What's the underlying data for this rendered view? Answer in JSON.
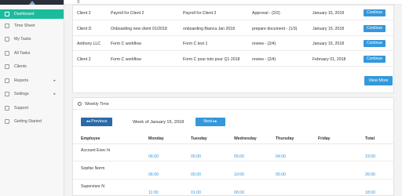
{
  "sidebar": {
    "items": [
      {
        "label": "Dashboard",
        "icon": "dashboard-icon"
      },
      {
        "label": "Time Sheet",
        "icon": "timesheet-icon"
      },
      {
        "label": "My Tasks",
        "icon": "tasks-icon"
      },
      {
        "label": "All Tasks",
        "icon": "all-tasks-icon"
      },
      {
        "label": "Clients",
        "icon": "clients-icon"
      },
      {
        "label": "Reports",
        "icon": "reports-icon",
        "caret": "▸"
      },
      {
        "label": "Settings",
        "icon": "gear-icon",
        "caret": "▸"
      },
      {
        "label": "Support",
        "icon": "support-icon"
      },
      {
        "label": "Getting Started",
        "icon": "rocket-icon"
      }
    ]
  },
  "tasks": {
    "rows": [
      {
        "client": "Client 2",
        "workflow": "Payroll for Client 2",
        "task": "Payroll for Client 2",
        "status": "Approval - (2/2)",
        "date": "January 15, 2018",
        "action": "Continue"
      },
      {
        "client": "Client D",
        "workflow": "Onboarding new client 01/2018",
        "task": "onboarding Bianca Jan 2018",
        "status": "prepare document - (1/3)",
        "date": "January 15, 2018",
        "action": "Continue"
      },
      {
        "client": "Anthony LLC",
        "workflow": "Form C workflow",
        "task": "Form C test 1",
        "status": "review - (2/4)",
        "date": "January 15, 2018",
        "action": "Continue"
      },
      {
        "client": "Client 2",
        "workflow": "Form C workflow",
        "task": "Form C pour toto pour Q1 2018",
        "status": "review - (2/4)",
        "date": "February 01, 2018",
        "action": "Continue"
      }
    ],
    "view_more": "View More"
  },
  "weekly": {
    "title": "Weekly Time",
    "prev_label": "◂◂ Previous",
    "next_label": "Next ▸▸",
    "week_label": "Week of January 15, 2018",
    "headers": [
      "Employee",
      "Monday",
      "Tuesday",
      "Wednesday",
      "Thursday",
      "Friday",
      "Total"
    ],
    "rows": [
      {
        "employee": "Account Exec hi",
        "values": [
          "06:00",
          "05:00",
          "05:00",
          "04:00",
          "",
          "19:00"
        ]
      },
      {
        "employee": "Sophie Norm",
        "values": [
          "06:00",
          "05:00",
          "10:00",
          "05:00",
          "",
          "26:00"
        ]
      },
      {
        "employee": "Supervisor N",
        "values": [
          "11:00",
          "01:00",
          "06:00",
          "",
          "",
          "18:00"
        ]
      }
    ]
  },
  "colors": {
    "accent": "#1abc9c",
    "primary": "#3498db",
    "dark_primary": "#2b6aa6"
  }
}
